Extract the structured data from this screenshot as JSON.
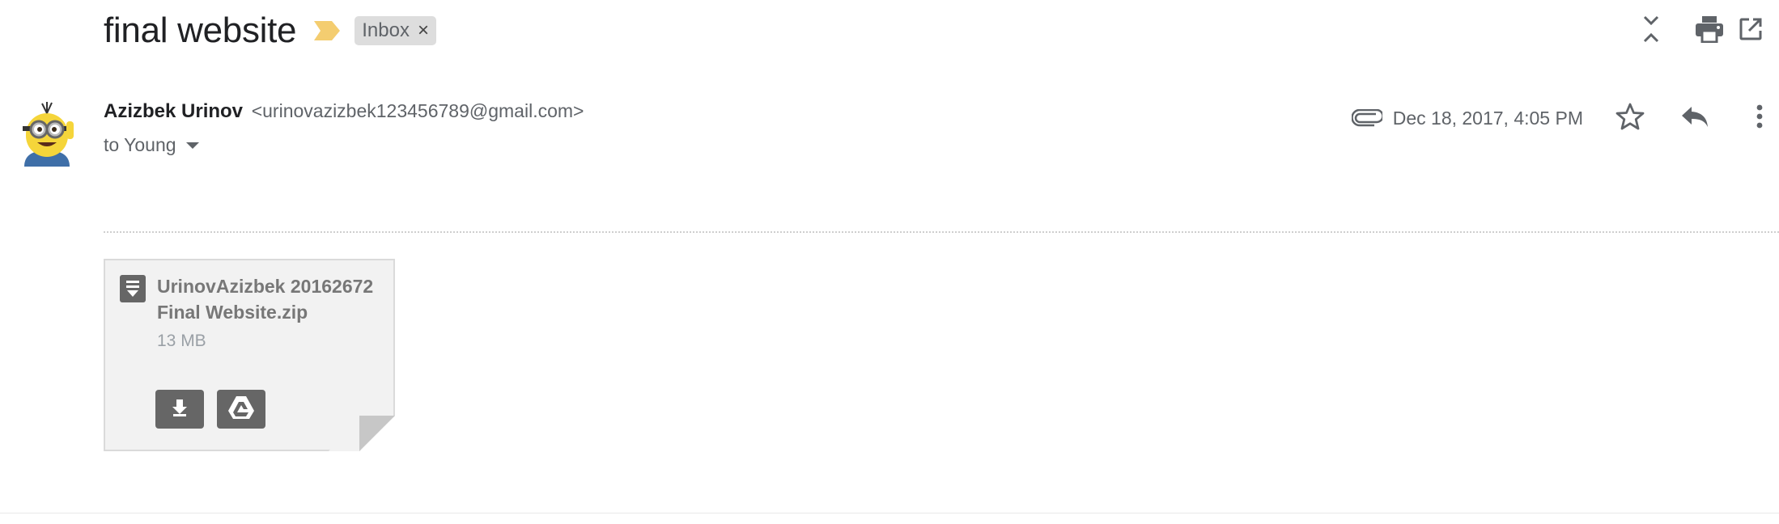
{
  "email": {
    "subject": "final website",
    "label": "Inbox",
    "label_remove": "×",
    "sender": {
      "name": "Azizbek Urinov",
      "email": "<urinovazizbek123456789@gmail.com>"
    },
    "recipient": "to Young",
    "date": "Dec 18, 2017, 4:05 PM"
  },
  "attachment": {
    "file_name": "UrinovAzizbek 20162672 Final Website.zip",
    "file_size": "13 MB"
  },
  "icons": {
    "importance": "label-important-icon",
    "collapse": "collapse-all-icon",
    "print": "print-icon",
    "open_new_window": "open-in-new-window-icon",
    "attachment": "paperclip-icon",
    "star": "star-icon",
    "reply": "reply-icon",
    "more": "more-vertical-icon",
    "file_type": "archive-file-icon",
    "download": "download-icon",
    "drive": "google-drive-icon"
  },
  "colors": {
    "importance_marker": "#f4cd70",
    "chip_background": "#dddddd",
    "icon_gray": "#5f6368",
    "attachment_button": "#666666"
  }
}
